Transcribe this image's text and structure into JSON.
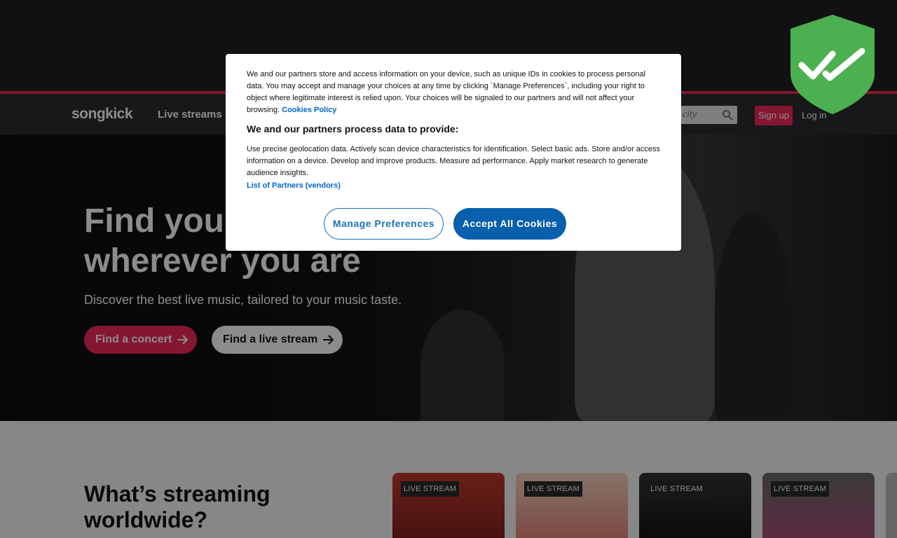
{
  "colors": {
    "brand": "#f2295b",
    "cookie_link": "#0066cc",
    "cookie_accept": "#0860ad",
    "shield": "#4caf50"
  },
  "nav": {
    "logo": "songkick",
    "live_streams": "Live streams",
    "search_placeholder": "or city",
    "search_icon": "search-icon",
    "signup": "Sign up",
    "login": "Log in"
  },
  "hero": {
    "title_line1": "Find you",
    "title_line2": "wherever you are",
    "subtitle": "Discover the best live music, tailored to your music taste.",
    "find_concert": "Find a concert",
    "find_stream": "Find a live stream",
    "arrow_icon": "arrow-right-icon"
  },
  "streaming": {
    "title": "What’s streaming worldwide?",
    "cards": [
      {
        "badge": "LIVE STREAM"
      },
      {
        "badge": "LIVE STREAM"
      },
      {
        "badge": "LIVE STREAM"
      },
      {
        "badge": "LIVE STREAM"
      }
    ]
  },
  "cookie": {
    "intro": "We and our partners store and access information on your device, such as unique IDs in cookies to process personal data. You may accept and manage your choices at any time by clicking `Manage Preferences`, including your right to object where legitimate interest is relied upon. Your choices will be signaled to our partners and will not affect your browsing.",
    "policy_link": "Cookies Policy",
    "heading": "We and our partners process data to provide:",
    "purposes": "Use precise geolocation data. Actively scan device characteristics for identification. Select basic ads. Store and/or access information on a device. Develop and improve products. Measure ad performance. Apply market research to generate audience insights.",
    "partners_link": "List of Partners (vendors)",
    "manage_button": "Manage Preferences",
    "accept_button": "Accept All Cookies"
  },
  "badge_icon": "shield-double-check-icon"
}
